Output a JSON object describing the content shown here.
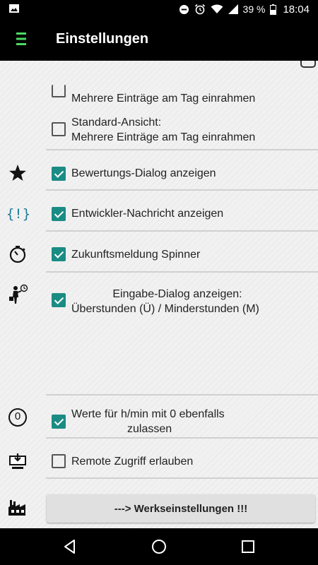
{
  "status_bar": {
    "battery_percent": "39 %",
    "clock": "18:04"
  },
  "app_bar": {
    "title": "Einstellungen"
  },
  "settings": {
    "calendar_frame_label": "Mehrere Einträge am Tag einrahmen",
    "standard_view_label_line1": "Standard-Ansicht:",
    "standard_view_label_line2": "Mehrere Einträge am Tag einrahmen",
    "rating_dialog_label": "Bewertungs-Dialog anzeigen",
    "rating_dialog_checked": true,
    "developer_message_label": "Entwickler-Nachricht anzeigen",
    "developer_message_checked": true,
    "future_spinner_label": "Zukunftsmeldung Spinner",
    "future_spinner_checked": true,
    "input_dialog_label_line1": "Eingabe-Dialog anzeigen:",
    "input_dialog_label_line2": "Überstunden (Ü) / Minderstunden (M)",
    "input_dialog_checked": true,
    "zero_values_label_line1": "Werte für h/min mit 0 ebenfalls",
    "zero_values_label_line2": "zulassen",
    "zero_values_checked": true,
    "remote_access_label": "Remote Zugriff erlauben",
    "remote_access_checked": false,
    "developer_icon_text": "{!}",
    "zero_icon_text": "0",
    "factory_button_label": "---> Werkseinstellungen !!!"
  },
  "colors": {
    "accent": "#1a8c84",
    "menu_icon": "#4cd964"
  },
  "icons": [
    "image-icon",
    "dnd-icon",
    "alarm-icon",
    "wifi-icon",
    "signal-icon",
    "battery-icon",
    "menu-icon",
    "star-icon",
    "developer-braces-icon",
    "timer-icon",
    "worker-clock-icon",
    "zero-circle-icon",
    "download-icon",
    "factory-icon",
    "back-icon",
    "home-icon",
    "recents-icon"
  ]
}
